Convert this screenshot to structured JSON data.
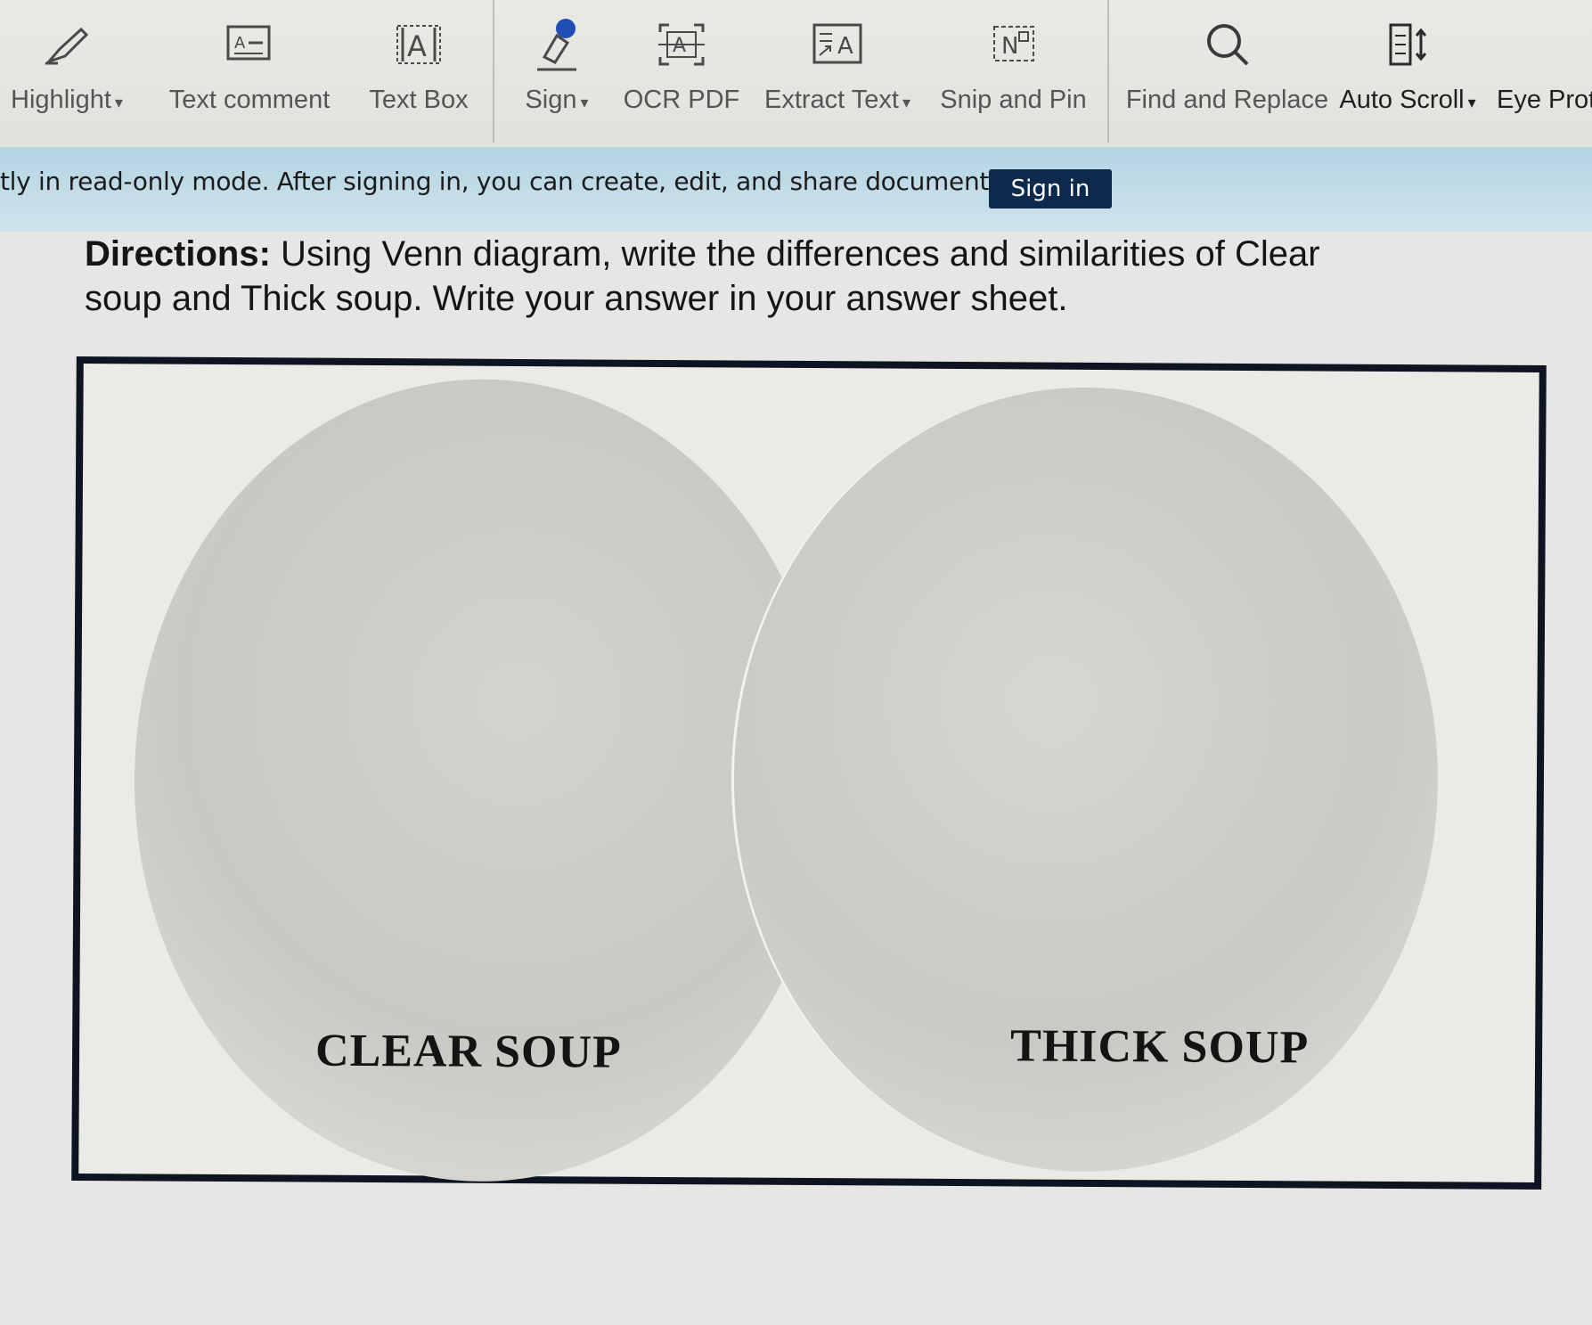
{
  "toolbar": {
    "items": [
      {
        "label": "Highlight",
        "caret": "▾",
        "icon": "highlighter-icon"
      },
      {
        "label": "Text comment",
        "caret": "",
        "icon": "text-comment-icon"
      },
      {
        "label": "Text Box",
        "caret": "",
        "icon": "text-box-icon"
      },
      {
        "label": "Sign",
        "caret": "▾",
        "icon": "sign-pen-icon"
      },
      {
        "label": "OCR PDF",
        "caret": "",
        "icon": "ocr-icon"
      },
      {
        "label": "Extract Text",
        "caret": "▾",
        "icon": "extract-text-icon"
      },
      {
        "label": "Snip and Pin",
        "caret": "",
        "icon": "snip-icon"
      },
      {
        "label": "Find and Replace",
        "caret": "",
        "icon": "search-icon"
      },
      {
        "label": "Auto Scroll",
        "caret": "▾",
        "icon": "auto-scroll-icon"
      },
      {
        "label": "Eye Prote",
        "caret": "",
        "icon": "eye-protection-icon"
      }
    ]
  },
  "banner": {
    "message": "tly in read-only mode. After signing in, you can create, edit, and share documents.",
    "button_label": "Sign in"
  },
  "document": {
    "directions_label": "Directions:",
    "directions_text": " Using Venn diagram, write the differences and similarities of Clear soup and Thick soup. Write your answer in your answer sheet.",
    "venn": {
      "left_label": "CLEAR SOUP",
      "right_label": "THICK SOUP"
    }
  }
}
